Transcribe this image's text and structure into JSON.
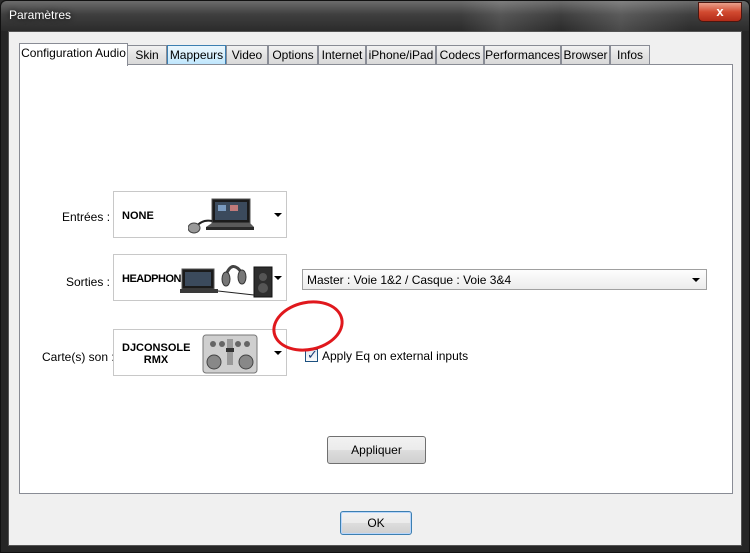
{
  "window": {
    "title": "Paramètres",
    "close_label": "x"
  },
  "tabs": [
    {
      "label": "Configuration Audio"
    },
    {
      "label": "Skin"
    },
    {
      "label": "Mappeurs"
    },
    {
      "label": "Video"
    },
    {
      "label": "Options"
    },
    {
      "label": "Internet"
    },
    {
      "label": "iPhone/iPad"
    },
    {
      "label": "Codecs"
    },
    {
      "label": "Performances"
    },
    {
      "label": "Browser"
    },
    {
      "label": "Infos"
    }
  ],
  "audio": {
    "inputs": {
      "label": "Entrées :",
      "device": "NONE"
    },
    "outputs": {
      "label": "Sorties :",
      "device": "HEADPHONES",
      "routing_value": "Master : Voie 1&2 / Casque : Voie 3&4"
    },
    "soundcard": {
      "label": "Carte(s) son :",
      "device_line1": "DJCONSOLE",
      "device_line2": "RMX",
      "apply_eq_label": "Apply Eq on external inputs",
      "apply_eq_checked": true
    },
    "apply_button": "Appliquer"
  },
  "footer": {
    "ok_button": "OK"
  },
  "colors": {
    "annotation_circle": "#e0181d",
    "title_text": "#ffffff"
  }
}
